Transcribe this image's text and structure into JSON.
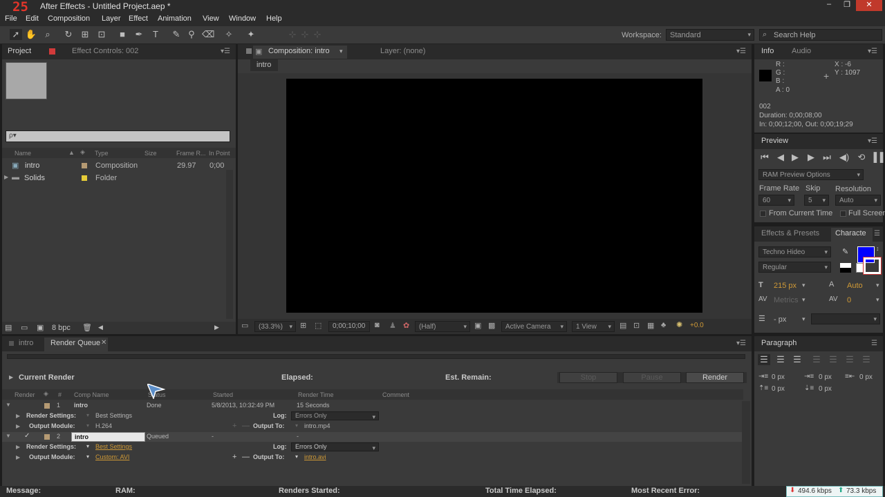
{
  "window": {
    "logo_text": "25",
    "title": "After Effects - Untitled Project.aep *",
    "controls": [
      "–",
      "❐",
      "✕"
    ]
  },
  "menu": [
    "File",
    "Edit",
    "Composition",
    "Layer",
    "Effect",
    "Animation",
    "View",
    "Window",
    "Help"
  ],
  "toolbar": {
    "workspace_label": "Workspace:",
    "workspace_value": "Standard",
    "search_help": "Search Help"
  },
  "project": {
    "tab_project": "Project",
    "tab_effect_controls": "Effect Controls: 002",
    "search_placeholder": "ρ▾",
    "columns": [
      "Name",
      "Type",
      "Size",
      "Frame R...",
      "In Point"
    ],
    "items": [
      {
        "name": "intro",
        "type": "Composition",
        "size": "",
        "frame_rate": "29.97",
        "in_point": "0;00",
        "color": "#b59a73"
      },
      {
        "name": "Solids",
        "type": "Folder",
        "size": "",
        "frame_rate": "",
        "in_point": "",
        "color": "#e6cc38"
      }
    ],
    "bpc": "8 bpc"
  },
  "composition": {
    "tab_label": "Composition: intro",
    "layer_label": "Layer: (none)",
    "breadcrumb": "intro",
    "zoom": "(33.3%)",
    "timecode": "0;00;10;00",
    "resolution": "(Half)",
    "camera": "Active Camera",
    "views": "1 View",
    "exposure": "+0.0"
  },
  "info": {
    "tab_info": "Info",
    "tab_audio": "Audio",
    "r": "R :",
    "g": "G :",
    "b": "B :",
    "a": "A : 0",
    "x": "X : -6",
    "y": "Y : 1097",
    "layer_name": "002",
    "duration": "Duration: 0;00;08;00",
    "in_out": "In: 0;00;12;00, Out: 0;00;19;29"
  },
  "preview": {
    "tab": "Preview",
    "ram_options": "RAM Preview Options",
    "frame_rate_label": "Frame Rate",
    "skip_label": "Skip",
    "resolution_label": "Resolution",
    "frame_rate": "60",
    "skip": "5",
    "resolution": "Auto",
    "from_current": "From Current Time",
    "full_screen": "Full Screen"
  },
  "character": {
    "tab_effects": "Effects & Presets",
    "tab_character": "Characte",
    "font": "Techno Hideo",
    "style": "Regular",
    "size": "215 px",
    "leading": "Auto",
    "kerning": "Metrics",
    "tracking": "0",
    "stroke": "- px",
    "fill_color": "#0000ff"
  },
  "paragraph": {
    "tab": "Paragraph",
    "indent_left": "0 px",
    "indent_first": "0 px",
    "indent_right": "0 px",
    "space_before": "0 px",
    "space_after": "0 px"
  },
  "render_queue": {
    "tab_intro": "intro",
    "tab_queue": "Render Queue",
    "current_render": "Current Render",
    "elapsed": "Elapsed:",
    "est_remain": "Est. Remain:",
    "stop": "Stop",
    "pause": "Pause",
    "render": "Render",
    "columns": [
      "Render",
      "#",
      "Comp Name",
      "Status",
      "Started",
      "Render Time",
      "Comment"
    ],
    "items": [
      {
        "num": "1",
        "comp": "intro",
        "status": "Done",
        "started": "5/8/2013, 10:32:49 PM",
        "render_time": "15 Seconds",
        "render_settings": "Best Settings",
        "output_module": "H.264",
        "log": "Errors Only",
        "output_to": "intro.mp4"
      },
      {
        "num": "2",
        "comp": "intro",
        "status": "Queued",
        "started": "-",
        "render_time": "-",
        "render_settings": "Best Settings",
        "output_module": "Custom: AVI",
        "log": "Errors Only",
        "output_to": "intro.avi"
      }
    ],
    "labels": {
      "render_settings": "Render Settings:",
      "output_module": "Output Module:",
      "log": "Log:",
      "output_to": "Output To:"
    }
  },
  "status_bar": {
    "message": "Message:",
    "ram": "RAM:",
    "renders_started": "Renders Started:",
    "total_time": "Total Time Elapsed:",
    "recent_error": "Most Recent Error:",
    "down_kbps": "494.6 kbps",
    "up_kbps": "73.3 kbps"
  }
}
